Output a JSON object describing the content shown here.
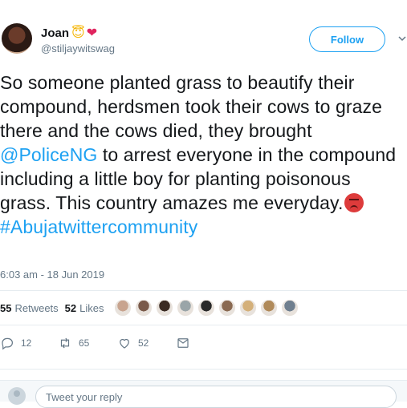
{
  "author": {
    "display_name": "Joan",
    "name_emojis": [
      "😇",
      "❤"
    ],
    "handle": "@stiljaywitswag",
    "avatar_icon": "avatar-photo"
  },
  "follow_button": {
    "label": "Follow",
    "color": "#1da1f2"
  },
  "tweet": {
    "text_part1": "So someone planted grass to beautify their compound, herdsmen took their cows to graze there and the cows died, they brought ",
    "mention": "@PoliceNG",
    "text_part2": " to arrest everyone in the compound including a little boy for planting poisonous grass. This country amazes me everyday.",
    "emoji": "angry-face",
    "hashtag": "#Abujatwittercommunity"
  },
  "timestamp": "6:03 am - 18 Jun 2019",
  "stats": {
    "retweets_count": "55",
    "retweets_label": "Retweets",
    "likes_count": "52",
    "likes_label": "Likes"
  },
  "likers": [
    {
      "color": "#c8a48f"
    },
    {
      "color": "#7a5a4a"
    },
    {
      "color": "#3a2a22"
    },
    {
      "color": "#9aa5a8"
    },
    {
      "color": "#2a2a2a"
    },
    {
      "color": "#8a6a52"
    },
    {
      "color": "#d4b07a"
    },
    {
      "color": "#b08a5a"
    },
    {
      "color": "#6f7f8f"
    }
  ],
  "actions": {
    "reply_count": "12",
    "retweet_count": "65",
    "like_count": "52"
  },
  "reply_bar": {
    "placeholder": "Tweet your reply"
  },
  "colors": {
    "accent": "#1da1f2",
    "muted": "#657786",
    "text": "#14171a"
  }
}
